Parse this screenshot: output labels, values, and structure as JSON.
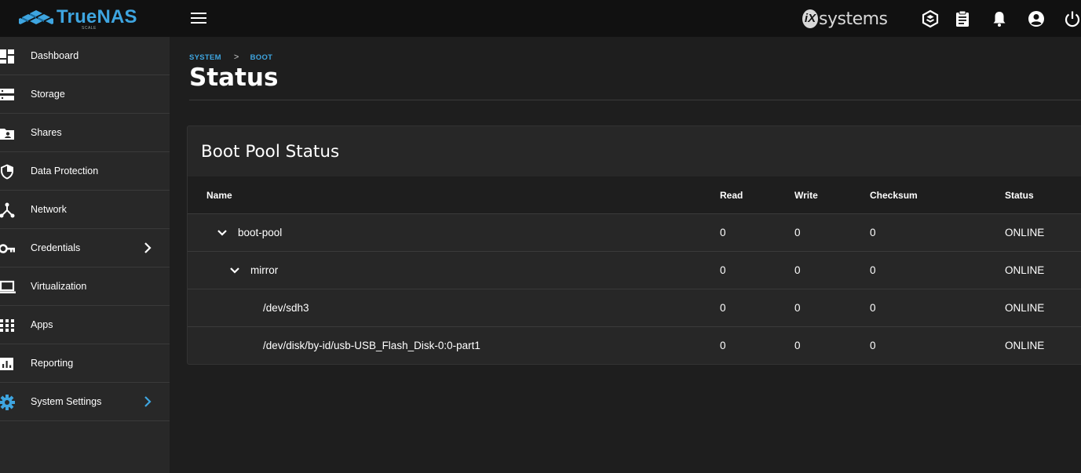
{
  "app": {
    "logo_text": "TrueNAS",
    "logo_subtext": "SCALE",
    "vendor_badge": "iX",
    "vendor_text": "systems"
  },
  "topbar": {
    "icons": [
      "menu-icon",
      "truecommand-icon",
      "clipboard-icon",
      "bell-icon",
      "account-icon",
      "power-icon"
    ]
  },
  "sidebar": {
    "items": [
      {
        "label": "Dashboard",
        "icon": "dashboard-icon"
      },
      {
        "label": "Storage",
        "icon": "storage-icon"
      },
      {
        "label": "Shares",
        "icon": "shares-icon"
      },
      {
        "label": "Data Protection",
        "icon": "shield-icon"
      },
      {
        "label": "Network",
        "icon": "network-icon"
      },
      {
        "label": "Credentials",
        "icon": "key-icon",
        "has_submenu": true
      },
      {
        "label": "Virtualization",
        "icon": "laptop-icon"
      },
      {
        "label": "Apps",
        "icon": "apps-grid-icon"
      },
      {
        "label": "Reporting",
        "icon": "bar-chart-icon"
      },
      {
        "label": "System Settings",
        "icon": "gear-icon",
        "has_submenu": true,
        "active": true
      }
    ]
  },
  "breadcrumb": {
    "items": [
      "SYSTEM",
      "BOOT"
    ],
    "separator": ">"
  },
  "page": {
    "title": "Status"
  },
  "card": {
    "title": "Boot Pool Status"
  },
  "table": {
    "columns": [
      "Name",
      "Read",
      "Write",
      "Checksum",
      "Status"
    ],
    "rows": [
      {
        "name": "boot-pool",
        "read": "0",
        "write": "0",
        "checksum": "0",
        "status": "ONLINE",
        "expandable": true,
        "level": 0
      },
      {
        "name": "mirror",
        "read": "0",
        "write": "0",
        "checksum": "0",
        "status": "ONLINE",
        "expandable": true,
        "level": 1
      },
      {
        "name": "/dev/sdh3",
        "read": "0",
        "write": "0",
        "checksum": "0",
        "status": "ONLINE",
        "expandable": false,
        "level": 2
      },
      {
        "name": "/dev/disk/by-id/usb-USB_Flash_Disk-0:0-part1",
        "read": "0",
        "write": "0",
        "checksum": "0",
        "status": "ONLINE",
        "expandable": false,
        "level": 2
      }
    ]
  },
  "colors": {
    "accent": "#3ea5e0",
    "topbar_bg": "#111111",
    "sidebar_bg": "#282828",
    "content_bg": "#1e1e1e",
    "card_bg": "#272727"
  }
}
